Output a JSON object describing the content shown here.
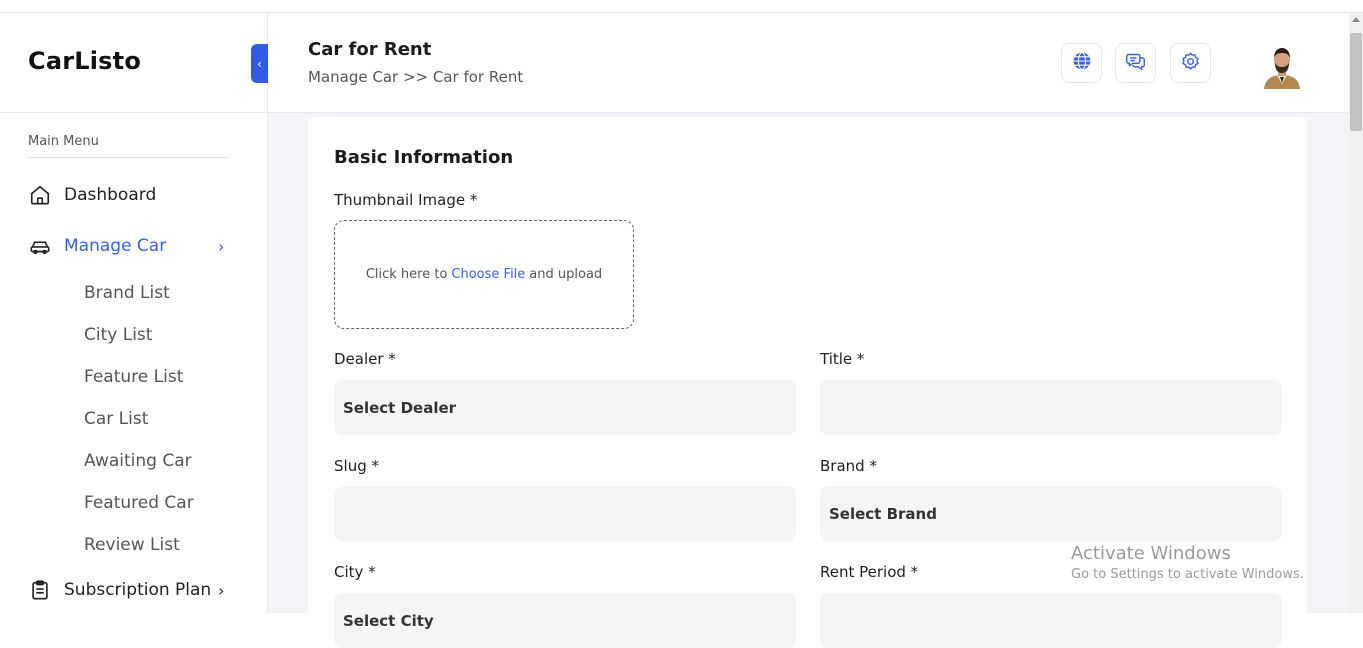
{
  "app": {
    "name": "CarListo"
  },
  "sidebar": {
    "menu_title": "Main Menu",
    "items": [
      {
        "label": "Dashboard",
        "icon": "home-icon"
      },
      {
        "label": "Manage Car",
        "icon": "car-icon",
        "active": true
      },
      {
        "label": "Subscription Plan",
        "icon": "clipboard-icon"
      }
    ],
    "sub_items": [
      {
        "label": "Brand List"
      },
      {
        "label": "City List"
      },
      {
        "label": "Feature List"
      },
      {
        "label": "Car List"
      },
      {
        "label": "Awaiting Car"
      },
      {
        "label": "Featured Car"
      },
      {
        "label": "Review List"
      }
    ]
  },
  "header": {
    "title": "Car for Rent",
    "breadcrumb": "Manage Car >> Car for Rent",
    "buttons": [
      "globe-icon",
      "chat-icon",
      "settings-icon"
    ]
  },
  "form": {
    "section_title": "Basic Information",
    "thumbnail": {
      "label": "Thumbnail Image *",
      "text_before": "Click here to",
      "link": "Choose File",
      "text_after": "and upload"
    },
    "dealer": {
      "label": "Dealer *",
      "value": "Select Dealer"
    },
    "title": {
      "label": "Title *",
      "value": ""
    },
    "slug": {
      "label": "Slug *",
      "value": ""
    },
    "brand": {
      "label": "Brand *",
      "value": "Select Brand"
    },
    "city": {
      "label": "City *",
      "value": "Select City"
    },
    "rent_period": {
      "label": "Rent Period *",
      "value": ""
    }
  },
  "watermark": {
    "title": "Activate Windows",
    "subtitle": "Go to Settings to activate Windows."
  },
  "colors": {
    "accent": "#3561e6",
    "collapse_button": "#2f5bea",
    "page_background": "#f3f4f7",
    "field_background": "#f5f5f6"
  }
}
